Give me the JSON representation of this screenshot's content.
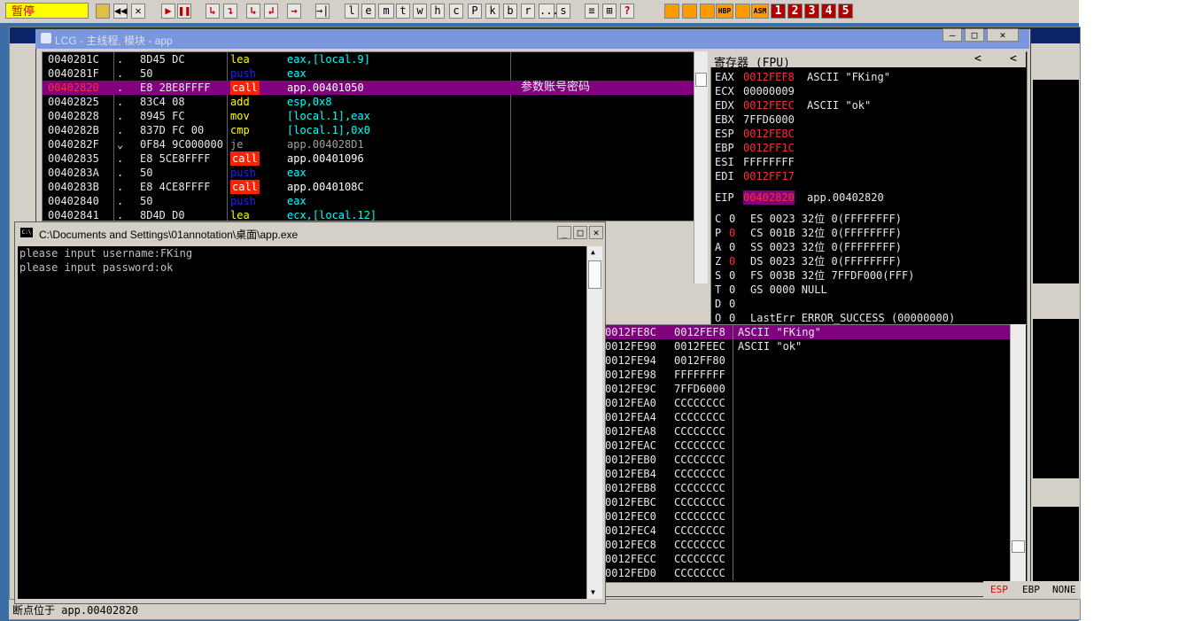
{
  "toolbar": {
    "status": "暂停",
    "buttons": [
      "◀◀",
      "✕",
      "▶",
      "❚❚",
      "↳",
      "↴",
      "↳",
      "↲",
      "→",
      "→|",
      "l",
      "e",
      "m",
      "t",
      "w",
      "h",
      "c",
      "P",
      "k",
      "b",
      "r",
      "...",
      "s",
      "≡",
      "⊞",
      "?"
    ],
    "plugins": [
      "HBP",
      "ASM"
    ],
    "numbers": [
      "1",
      "2",
      "3",
      "4",
      "5"
    ]
  },
  "cpu_window": {
    "title": "LCG - 主线程, 模块 - app",
    "min": "—",
    "max": "□",
    "close": "✕"
  },
  "disasm": [
    {
      "addr": "0040281C",
      "dot": ".",
      "hex": "8D45 DC",
      "mn": "lea",
      "op": "eax,[local.9]",
      "cm": ""
    },
    {
      "addr": "0040281F",
      "dot": ".",
      "hex": "50",
      "mn": "push",
      "op": "eax",
      "cm": ""
    },
    {
      "addr": "00402820",
      "dot": ".",
      "hex": "E8 2BE8FFFF",
      "mn": "call",
      "op": "app.00401050",
      "cm": "参数账号密码"
    },
    {
      "addr": "00402825",
      "dot": ".",
      "hex": "83C4 08",
      "mn": "add",
      "op": "esp,0x8",
      "cm": ""
    },
    {
      "addr": "00402828",
      "dot": ".",
      "hex": "8945 FC",
      "mn": "mov",
      "op": "[local.1],eax",
      "cm": ""
    },
    {
      "addr": "0040282B",
      "dot": ".",
      "hex": "837D FC 00",
      "mn": "cmp",
      "op": "[local.1],0x0",
      "cm": ""
    },
    {
      "addr": "0040282F",
      "dot": "⌄",
      "hex": "0F84 9C000000",
      "mn": "je",
      "op": "app.004028D1",
      "cm": ""
    },
    {
      "addr": "00402835",
      "dot": ".",
      "hex": "E8 5CE8FFFF",
      "mn": "call",
      "op": "app.00401096",
      "cm": ""
    },
    {
      "addr": "0040283A",
      "dot": ".",
      "hex": "50",
      "mn": "push",
      "op": "eax",
      "cm": ""
    },
    {
      "addr": "0040283B",
      "dot": ".",
      "hex": "E8 4CE8FFFF",
      "mn": "call",
      "op": "app.0040108C",
      "cm": ""
    },
    {
      "addr": "00402840",
      "dot": ".",
      "hex": "50",
      "mn": "push",
      "op": "eax",
      "cm": ""
    },
    {
      "addr": "00402841",
      "dot": ".",
      "hex": "8D4D D0",
      "mn": "lea",
      "op": "ecx,[local.12]",
      "cm": ""
    }
  ],
  "registers": {
    "header": "寄存器 (FPU)",
    "nav": [
      "<",
      "<"
    ],
    "gp": [
      {
        "name": "EAX",
        "val": "0012FEF8",
        "extra": "ASCII \"FKing\""
      },
      {
        "name": "ECX",
        "val": "00000009",
        "extra": ""
      },
      {
        "name": "EDX",
        "val": "0012FEEC",
        "extra": "ASCII \"ok\""
      },
      {
        "name": "EBX",
        "val": "7FFD6000",
        "extra": ""
      },
      {
        "name": "ESP",
        "val": "0012FE8C",
        "extra": ""
      },
      {
        "name": "EBP",
        "val": "0012FF1C",
        "extra": ""
      },
      {
        "name": "ESI",
        "val": "FFFFFFFF",
        "extra": ""
      },
      {
        "name": "EDI",
        "val": "0012FF17",
        "extra": ""
      }
    ],
    "eip": {
      "name": "EIP",
      "val": "00402820",
      "extra": "app.00402820"
    },
    "flags": [
      {
        "f": "C",
        "v": "0",
        "seg": "ES 0023 32位 0(FFFFFFFF)"
      },
      {
        "f": "P",
        "v": "0",
        "seg": "CS 001B 32位 0(FFFFFFFF)"
      },
      {
        "f": "A",
        "v": "0",
        "seg": "SS 0023 32位 0(FFFFFFFF)"
      },
      {
        "f": "Z",
        "v": "0",
        "seg": "DS 0023 32位 0(FFFFFFFF)"
      },
      {
        "f": "S",
        "v": "0",
        "seg": "FS 003B 32位 7FFDF000(FFF)"
      },
      {
        "f": "T",
        "v": "0",
        "seg": "GS 0000 NULL"
      },
      {
        "f": "D",
        "v": "0",
        "seg": ""
      },
      {
        "f": "O",
        "v": "0",
        "seg": "LastErr ERROR_SUCCESS (00000000)"
      }
    ]
  },
  "stack": [
    {
      "addr": "0012FE8C",
      "val": "0012FEF8",
      "cm": "ASCII \"FKing\""
    },
    {
      "addr": "0012FE90",
      "val": "0012FEEC",
      "cm": "ASCII \"ok\""
    },
    {
      "addr": "0012FE94",
      "val": "0012FF80",
      "cm": ""
    },
    {
      "addr": "0012FE98",
      "val": "FFFFFFFF",
      "cm": ""
    },
    {
      "addr": "0012FE9C",
      "val": "7FFD6000",
      "cm": ""
    },
    {
      "addr": "0012FEA0",
      "val": "CCCCCCCC",
      "cm": ""
    },
    {
      "addr": "0012FEA4",
      "val": "CCCCCCCC",
      "cm": ""
    },
    {
      "addr": "0012FEA8",
      "val": "CCCCCCCC",
      "cm": ""
    },
    {
      "addr": "0012FEAC",
      "val": "CCCCCCCC",
      "cm": ""
    },
    {
      "addr": "0012FEB0",
      "val": "CCCCCCCC",
      "cm": ""
    },
    {
      "addr": "0012FEB4",
      "val": "CCCCCCCC",
      "cm": ""
    },
    {
      "addr": "0012FEB8",
      "val": "CCCCCCCC",
      "cm": ""
    },
    {
      "addr": "0012FEBC",
      "val": "CCCCCCCC",
      "cm": ""
    },
    {
      "addr": "0012FEC0",
      "val": "CCCCCCCC",
      "cm": ""
    },
    {
      "addr": "0012FEC4",
      "val": "CCCCCCCC",
      "cm": ""
    },
    {
      "addr": "0012FEC8",
      "val": "CCCCCCCC",
      "cm": ""
    },
    {
      "addr": "0012FECC",
      "val": "CCCCCCCC",
      "cm": ""
    },
    {
      "addr": "0012FED0",
      "val": "CCCCCCCC",
      "cm": ""
    }
  ],
  "stack_footer": {
    "esp": "ESP",
    "ebp": "EBP",
    "none": "NONE"
  },
  "statusbar": {
    "text": "断点位于 app.00402820"
  },
  "console": {
    "title": "C:\\Documents and Settings\\01annotation\\桌面\\app.exe",
    "icon": "C:\\",
    "min": "_",
    "max": "□",
    "close": "✕",
    "lines": [
      "please input username:FKing",
      "please input password:ok"
    ]
  },
  "colors": {
    "highlight_purple": "#800080",
    "reg_changed": "#ff3030",
    "call_bg": "#ff2000",
    "push_blue": "#2020ff",
    "mnemonic_yellow": "#ffff00",
    "operand_cyan": "#00ffff"
  }
}
